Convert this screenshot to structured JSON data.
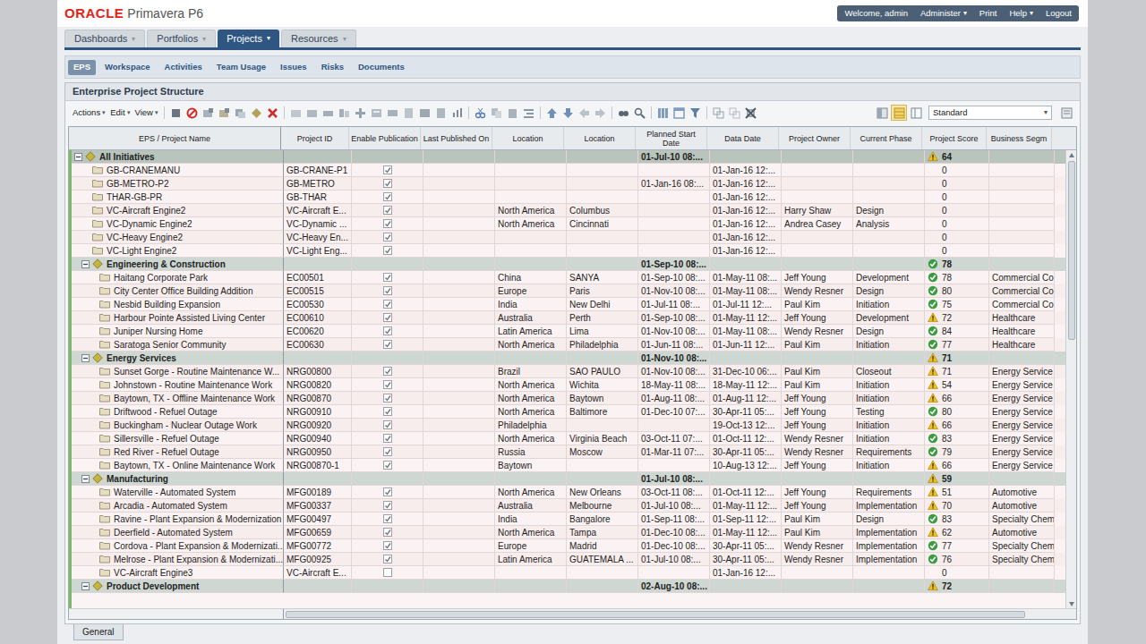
{
  "header": {
    "brand": "ORACLE",
    "product": "Primavera P6",
    "user_menu": [
      {
        "label": "Welcome, admin",
        "arrow": ""
      },
      {
        "label": "Administer",
        "arrow": "▾"
      },
      {
        "label": "Print",
        "arrow": ""
      },
      {
        "label": "Help",
        "arrow": "▾"
      },
      {
        "label": "Logout",
        "arrow": ""
      }
    ]
  },
  "nav_tabs": [
    {
      "label": "Dashboards",
      "arrow": "▾",
      "selected": false
    },
    {
      "label": "Portfolios",
      "arrow": "▾",
      "selected": false
    },
    {
      "label": "Projects",
      "arrow": "▾",
      "selected": true
    },
    {
      "label": "Resources",
      "arrow": "▾",
      "selected": false
    }
  ],
  "sub_tabs": [
    {
      "label": "EPS",
      "selected": true
    },
    {
      "label": "Workspace",
      "selected": false
    },
    {
      "label": "Activities",
      "selected": false
    },
    {
      "label": "Team Usage",
      "selected": false
    },
    {
      "label": "Issues",
      "selected": false
    },
    {
      "label": "Risks",
      "selected": false
    },
    {
      "label": "Documents",
      "selected": false
    }
  ],
  "panel": {
    "title": "Enterprise Project Structure"
  },
  "toolbar": {
    "menus": [
      {
        "label": "Actions",
        "arrow": "▾"
      },
      {
        "label": "Edit",
        "arrow": "▾"
      },
      {
        "label": "View",
        "arrow": "▾"
      }
    ],
    "layout": "Standard",
    "layout_arrow": "▾"
  },
  "table": {
    "columns": [
      "EPS / Project Name",
      "Project ID",
      "Enable Publication",
      "Last Published On",
      "Location",
      "Location",
      "Planned Start Date",
      "Data Date",
      "Project Owner",
      "Current Phase",
      "Project Score",
      "Business Segm"
    ],
    "rows": [
      {
        "kind": "group",
        "depth": 0,
        "expanded": true,
        "name": "All Initiatives",
        "id": "",
        "published": "",
        "loc1": "",
        "loc2": "",
        "start": "01-Jul-10 08:...",
        "data_date": "",
        "owner": "",
        "phase": "",
        "score": "64",
        "score_status": "warning",
        "segment": ""
      },
      {
        "kind": "project",
        "depth": 1,
        "name": "GB-CRANEMANU",
        "id": "GB-CRANE-P1",
        "checked": true,
        "published": "",
        "loc1": "",
        "loc2": "",
        "start": "",
        "data_date": "01-Jan-16 12:...",
        "owner": "",
        "phase": "",
        "score": "0",
        "score_status": "none",
        "segment": ""
      },
      {
        "kind": "project",
        "depth": 1,
        "name": "GB-METRO-P2",
        "id": "GB-METRO",
        "checked": true,
        "published": "",
        "loc1": "",
        "loc2": "",
        "start": "01-Jan-16 08:...",
        "data_date": "01-Jan-16 12:...",
        "owner": "",
        "phase": "",
        "score": "0",
        "score_status": "none",
        "segment": ""
      },
      {
        "kind": "project",
        "depth": 1,
        "name": "THAR-GB-PR",
        "id": "GB-THAR",
        "checked": true,
        "published": "",
        "loc1": "",
        "loc2": "",
        "start": "",
        "data_date": "01-Jan-16 12:...",
        "owner": "",
        "phase": "",
        "score": "0",
        "score_status": "none",
        "segment": ""
      },
      {
        "kind": "project",
        "depth": 1,
        "name": "VC-Aircraft Engine2",
        "id": "VC-Aircraft E...",
        "checked": true,
        "published": "",
        "loc1": "North America",
        "loc2": "Columbus",
        "start": "",
        "data_date": "01-Jan-16 12:...",
        "owner": "Harry Shaw",
        "phase": "Design",
        "score": "0",
        "score_status": "none",
        "segment": ""
      },
      {
        "kind": "project",
        "depth": 1,
        "name": "VC-Dynamic Engine2",
        "id": "VC-Dynamic ...",
        "checked": true,
        "published": "",
        "loc1": "North America",
        "loc2": "Cincinnati",
        "start": "",
        "data_date": "01-Jan-16 12:...",
        "owner": "Andrea Casey",
        "phase": "Analysis",
        "score": "0",
        "score_status": "none",
        "segment": ""
      },
      {
        "kind": "project",
        "depth": 1,
        "name": "VC-Heavy Engine2",
        "id": "VC-Heavy En...",
        "checked": true,
        "published": "",
        "loc1": "",
        "loc2": "",
        "start": "",
        "data_date": "01-Jan-16 12:...",
        "owner": "",
        "phase": "",
        "score": "0",
        "score_status": "none",
        "segment": ""
      },
      {
        "kind": "project",
        "depth": 1,
        "name": "VC-Light Engine2",
        "id": "VC-Light Eng...",
        "checked": true,
        "published": "",
        "loc1": "",
        "loc2": "",
        "start": "",
        "data_date": "01-Jan-16 12:...",
        "owner": "",
        "phase": "",
        "score": "0",
        "score_status": "none",
        "segment": ""
      },
      {
        "kind": "group",
        "depth": 1,
        "expanded": true,
        "name": "Engineering & Construction",
        "id": "",
        "published": "",
        "loc1": "",
        "loc2": "",
        "start": "01-Sep-10 08:...",
        "data_date": "",
        "owner": "",
        "phase": "",
        "score": "78",
        "score_status": "ok",
        "segment": ""
      },
      {
        "kind": "project",
        "depth": 2,
        "name": "Haitang Corporate Park",
        "id": "EC00501",
        "checked": true,
        "published": "",
        "loc1": "China",
        "loc2": "SANYA",
        "start": "01-Sep-10 08:...",
        "data_date": "01-May-11 08:...",
        "owner": "Jeff Young",
        "phase": "Development",
        "score": "78",
        "score_status": "ok",
        "segment": "Commercial Co"
      },
      {
        "kind": "project",
        "depth": 2,
        "name": "City Center Office Building Addition",
        "id": "EC00515",
        "checked": true,
        "published": "",
        "loc1": "Europe",
        "loc2": "Paris",
        "start": "01-Nov-10 08:...",
        "data_date": "01-May-11 08:...",
        "owner": "Wendy Resner",
        "phase": "Design",
        "score": "80",
        "score_status": "ok",
        "segment": "Commercial Co"
      },
      {
        "kind": "project",
        "depth": 2,
        "name": "Nesbid Building Expansion",
        "id": "EC00530",
        "checked": true,
        "published": "",
        "loc1": "India",
        "loc2": "New Delhi",
        "start": "01-Jul-11 08:...",
        "data_date": "01-Jul-11 12:...",
        "owner": "Paul Kim",
        "phase": "Initiation",
        "score": "75",
        "score_status": "ok",
        "segment": "Commercial Co"
      },
      {
        "kind": "project",
        "depth": 2,
        "name": "Harbour Pointe Assisted Living Center",
        "id": "EC00610",
        "checked": true,
        "published": "",
        "loc1": "Australia",
        "loc2": "Perth",
        "start": "01-Sep-10 08:...",
        "data_date": "01-May-11 12:...",
        "owner": "Jeff Young",
        "phase": "Development",
        "score": "72",
        "score_status": "warning",
        "segment": "Healthcare"
      },
      {
        "kind": "project",
        "depth": 2,
        "name": "Juniper Nursing Home",
        "id": "EC00620",
        "checked": true,
        "published": "",
        "loc1": "Latin America",
        "loc2": "Lima",
        "start": "01-Nov-10 08:...",
        "data_date": "01-May-11 08:...",
        "owner": "Wendy Resner",
        "phase": "Design",
        "score": "84",
        "score_status": "ok",
        "segment": "Healthcare"
      },
      {
        "kind": "project",
        "depth": 2,
        "name": "Saratoga Senior Community",
        "id": "EC00630",
        "checked": true,
        "published": "",
        "loc1": "North America",
        "loc2": "Philadelphia",
        "start": "01-Jun-11 08:...",
        "data_date": "01-Jun-11 12:...",
        "owner": "Paul Kim",
        "phase": "Initiation",
        "score": "77",
        "score_status": "ok",
        "segment": "Healthcare"
      },
      {
        "kind": "group",
        "depth": 1,
        "expanded": true,
        "name": "Energy Services",
        "id": "",
        "published": "",
        "loc1": "",
        "loc2": "",
        "start": "01-Nov-10 08:...",
        "data_date": "",
        "owner": "",
        "phase": "",
        "score": "71",
        "score_status": "warning",
        "segment": ""
      },
      {
        "kind": "project",
        "depth": 2,
        "name": "Sunset Gorge - Routine Maintenance W...",
        "id": "NRG00800",
        "checked": true,
        "published": "",
        "loc1": "Brazil",
        "loc2": "SAO PAULO",
        "start": "01-Nov-10 08:...",
        "data_date": "31-Dec-10 06:...",
        "owner": "Paul Kim",
        "phase": "Closeout",
        "score": "71",
        "score_status": "warning",
        "segment": "Energy Service"
      },
      {
        "kind": "project",
        "depth": 2,
        "name": "Johnstown - Routine Maintenance Work",
        "id": "NRG00820",
        "checked": true,
        "published": "",
        "loc1": "North America",
        "loc2": "Wichita",
        "start": "18-May-11 08:...",
        "data_date": "18-May-11 12:...",
        "owner": "Paul Kim",
        "phase": "Initiation",
        "score": "54",
        "score_status": "warning",
        "segment": "Energy Service"
      },
      {
        "kind": "project",
        "depth": 2,
        "name": "Baytown, TX - Offline Maintenance Work",
        "id": "NRG00870",
        "checked": true,
        "published": "",
        "loc1": "North America",
        "loc2": "Baytown",
        "start": "01-Aug-11 08:...",
        "data_date": "01-Aug-11 12:...",
        "owner": "Jeff Young",
        "phase": "Initiation",
        "score": "66",
        "score_status": "warning",
        "segment": "Energy Service"
      },
      {
        "kind": "project",
        "depth": 2,
        "name": "Driftwood - Refuel Outage",
        "id": "NRG00910",
        "checked": true,
        "published": "",
        "loc1": "North America",
        "loc2": "Baltimore",
        "start": "01-Dec-10 07:...",
        "data_date": "30-Apr-11 05:...",
        "owner": "Jeff Young",
        "phase": "Testing",
        "score": "80",
        "score_status": "ok",
        "segment": "Energy Service"
      },
      {
        "kind": "project",
        "depth": 2,
        "name": "Buckingham - Nuclear Outage Work",
        "id": "NRG00920",
        "checked": true,
        "published": "",
        "loc1": "Philadelphia",
        "loc2": "",
        "start": "",
        "data_date": "19-Oct-13 12:...",
        "owner": "Jeff Young",
        "phase": "Initiation",
        "score": "66",
        "score_status": "warning",
        "segment": "Energy Service"
      },
      {
        "kind": "project",
        "depth": 2,
        "name": "Sillersville - Refuel Outage",
        "id": "NRG00940",
        "checked": true,
        "published": "",
        "loc1": "North America",
        "loc2": "Virginia Beach",
        "start": "03-Oct-11 07:...",
        "data_date": "01-Oct-11 12:...",
        "owner": "Wendy Resner",
        "phase": "Initiation",
        "score": "83",
        "score_status": "ok",
        "segment": "Energy Service"
      },
      {
        "kind": "project",
        "depth": 2,
        "name": "Red River - Refuel Outage",
        "id": "NRG00950",
        "checked": true,
        "published": "",
        "loc1": "Russia",
        "loc2": "Moscow",
        "start": "01-Mar-11 07:...",
        "data_date": "30-Apr-11 05:...",
        "owner": "Wendy Resner",
        "phase": "Requirements",
        "score": "79",
        "score_status": "ok",
        "segment": "Energy Service"
      },
      {
        "kind": "project",
        "depth": 2,
        "name": "Baytown, TX - Online Maintenance Work",
        "id": "NRG00870-1",
        "checked": true,
        "published": "",
        "loc1": "Baytown",
        "loc2": "",
        "start": "",
        "data_date": "10-Aug-13 12:...",
        "owner": "Jeff Young",
        "phase": "Initiation",
        "score": "66",
        "score_status": "warning",
        "segment": "Energy Service"
      },
      {
        "kind": "group",
        "depth": 1,
        "expanded": true,
        "name": "Manufacturing",
        "id": "",
        "published": "",
        "loc1": "",
        "loc2": "",
        "start": "01-Jul-10 08:...",
        "data_date": "",
        "owner": "",
        "phase": "",
        "score": "59",
        "score_status": "warning",
        "segment": ""
      },
      {
        "kind": "project",
        "depth": 2,
        "name": "Waterville - Automated System",
        "id": "MFG00189",
        "checked": true,
        "published": "",
        "loc1": "North America",
        "loc2": "New Orleans",
        "start": "03-Oct-11 08:...",
        "data_date": "01-Oct-11 12:...",
        "owner": "Jeff Young",
        "phase": "Requirements",
        "score": "51",
        "score_status": "warning",
        "segment": "Automotive"
      },
      {
        "kind": "project",
        "depth": 2,
        "name": "Arcadia - Automated System",
        "id": "MFG00337",
        "checked": true,
        "published": "",
        "loc1": "Australia",
        "loc2": "Melbourne",
        "start": "01-Jul-10 08:...",
        "data_date": "01-May-11 12:...",
        "owner": "Jeff Young",
        "phase": "Implementation",
        "score": "70",
        "score_status": "warning",
        "segment": "Automotive"
      },
      {
        "kind": "project",
        "depth": 2,
        "name": "Ravine - Plant Expansion & Modernization",
        "id": "MFG00497",
        "checked": true,
        "published": "",
        "loc1": "India",
        "loc2": "Bangalore",
        "start": "01-Sep-11 08:...",
        "data_date": "01-Sep-11 12:...",
        "owner": "Paul Kim",
        "phase": "Design",
        "score": "83",
        "score_status": "ok",
        "segment": "Specialty Chem"
      },
      {
        "kind": "project",
        "depth": 2,
        "name": "Deerfield - Automated System",
        "id": "MFG00659",
        "checked": true,
        "published": "",
        "loc1": "North America",
        "loc2": "Tampa",
        "start": "01-Dec-10 08:...",
        "data_date": "01-May-11 12:...",
        "owner": "Paul Kim",
        "phase": "Implementation",
        "score": "62",
        "score_status": "warning",
        "segment": "Automotive"
      },
      {
        "kind": "project",
        "depth": 2,
        "name": "Cordova - Plant Expansion & Modernizati...",
        "id": "MFG00772",
        "checked": true,
        "published": "",
        "loc1": "Europe",
        "loc2": "Madrid",
        "start": "01-Dec-10 08:...",
        "data_date": "30-Apr-11 05:...",
        "owner": "Wendy Resner",
        "phase": "Implementation",
        "score": "77",
        "score_status": "ok",
        "segment": "Specialty Chem"
      },
      {
        "kind": "project",
        "depth": 2,
        "name": "Melrose - Plant Expansion & Modernizati...",
        "id": "MFG00925",
        "checked": true,
        "published": "",
        "loc1": "Latin America",
        "loc2": "GUATEMALA ...",
        "start": "01-Jul-10 08:...",
        "data_date": "30-Apr-11 05:...",
        "owner": "Wendy Resner",
        "phase": "Implementation",
        "score": "76",
        "score_status": "ok",
        "segment": "Specialty Chem"
      },
      {
        "kind": "project",
        "depth": 2,
        "name": "VC-Aircraft Engine3",
        "id": "VC-Aircraft E...",
        "checked": false,
        "published": "",
        "loc1": "",
        "loc2": "",
        "start": "",
        "data_date": "01-Jan-16 12:...",
        "owner": "",
        "phase": "",
        "score": "0",
        "score_status": "none",
        "segment": ""
      },
      {
        "kind": "group",
        "depth": 1,
        "expanded": true,
        "name": "Product Development",
        "id": "",
        "published": "",
        "loc1": "",
        "loc2": "",
        "start": "02-Aug-10 08:...",
        "data_date": "",
        "owner": "",
        "phase": "",
        "score": "72",
        "score_status": "warning",
        "segment": ""
      }
    ]
  },
  "footer_tabs": [
    {
      "label": "General",
      "selected": true
    }
  ]
}
